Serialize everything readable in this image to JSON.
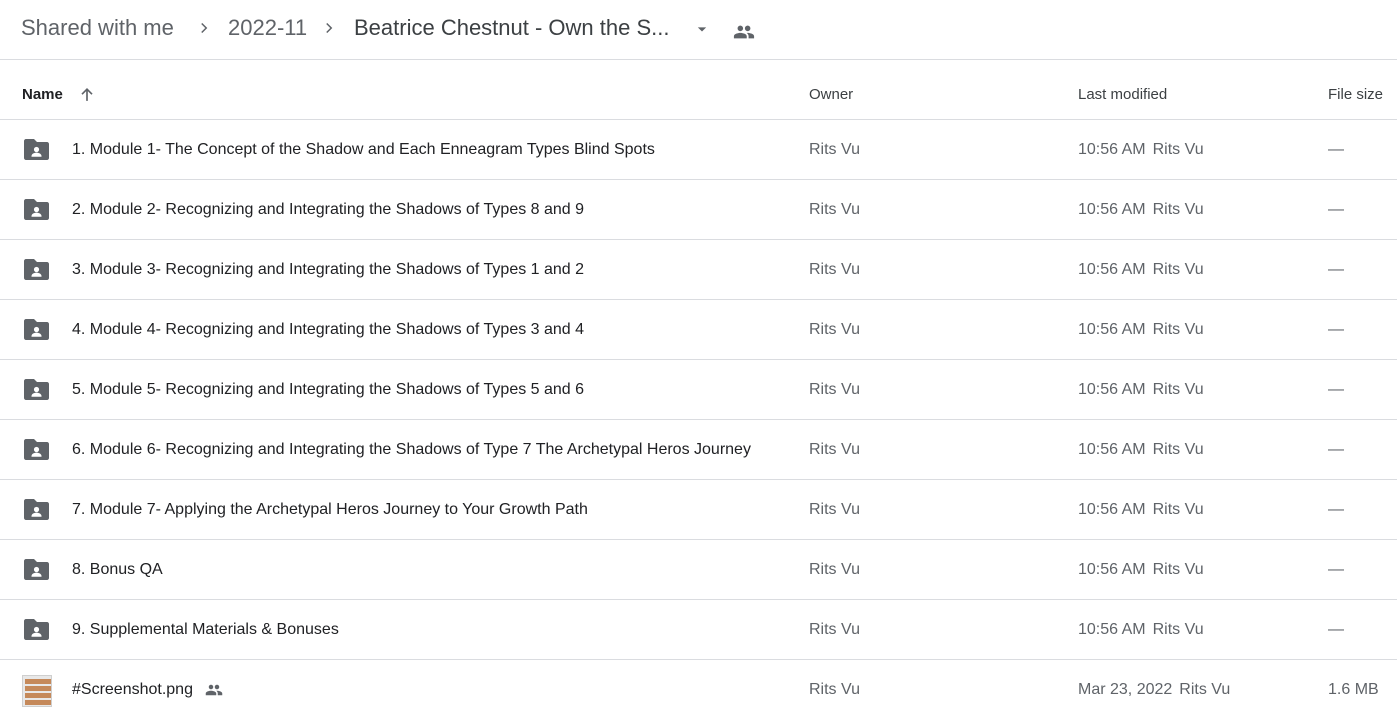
{
  "breadcrumb": {
    "items": [
      "Shared with me",
      "2022-11",
      "Beatrice Chestnut - Own the S..."
    ],
    "icons": {
      "separator": "chevron-right-icon",
      "dropdown": "arrow-drop-down-icon",
      "shared": "people-icon"
    }
  },
  "table": {
    "columns": {
      "name": "Name",
      "owner": "Owner",
      "last_modified": "Last modified",
      "file_size": "File size"
    },
    "sort": {
      "column": "name",
      "direction": "ascending",
      "icon": "arrow-upward-icon"
    },
    "rows": [
      {
        "type": "shared-folder",
        "name": "1. Module 1- The Concept of the Shadow and Each Enneagram Types Blind Spots",
        "owner": "Rits Vu",
        "modified": "10:56 AM",
        "modified_by": "Rits Vu",
        "size": "—"
      },
      {
        "type": "shared-folder",
        "name": "2. Module 2- Recognizing and Integrating the Shadows of Types 8 and 9",
        "owner": "Rits Vu",
        "modified": "10:56 AM",
        "modified_by": "Rits Vu",
        "size": "—"
      },
      {
        "type": "shared-folder",
        "name": "3. Module 3- Recognizing and Integrating the Shadows of Types 1 and 2",
        "owner": "Rits Vu",
        "modified": "10:56 AM",
        "modified_by": "Rits Vu",
        "size": "—"
      },
      {
        "type": "shared-folder",
        "name": "4. Module 4- Recognizing and Integrating the Shadows of Types 3 and 4",
        "owner": "Rits Vu",
        "modified": "10:56 AM",
        "modified_by": "Rits Vu",
        "size": "—"
      },
      {
        "type": "shared-folder",
        "name": "5. Module 5- Recognizing and Integrating the Shadows of Types 5 and 6",
        "owner": "Rits Vu",
        "modified": "10:56 AM",
        "modified_by": "Rits Vu",
        "size": "—"
      },
      {
        "type": "shared-folder",
        "name": "6. Module 6- Recognizing and Integrating the Shadows of Type 7  The Archetypal Heros Journey",
        "owner": "Rits Vu",
        "modified": "10:56 AM",
        "modified_by": "Rits Vu",
        "size": "—"
      },
      {
        "type": "shared-folder",
        "name": "7. Module 7- Applying the Archetypal Heros Journey to Your Growth Path",
        "owner": "Rits Vu",
        "modified": "10:56 AM",
        "modified_by": "Rits Vu",
        "size": "—"
      },
      {
        "type": "shared-folder",
        "name": "8. Bonus QA",
        "owner": "Rits Vu",
        "modified": "10:56 AM",
        "modified_by": "Rits Vu",
        "size": "—"
      },
      {
        "type": "shared-folder",
        "name": "9. Supplemental Materials & Bonuses",
        "owner": "Rits Vu",
        "modified": "10:56 AM",
        "modified_by": "Rits Vu",
        "size": "—"
      },
      {
        "type": "image",
        "name": "#Screenshot.png",
        "shared": true,
        "owner": "Rits Vu",
        "modified": "Mar 23, 2022",
        "modified_by": "Rits Vu",
        "size": "1.6 MB"
      }
    ]
  },
  "colors": {
    "icon": "#5f6368",
    "divider": "#dadce0",
    "text": "#202124",
    "muted": "#5f6368"
  }
}
